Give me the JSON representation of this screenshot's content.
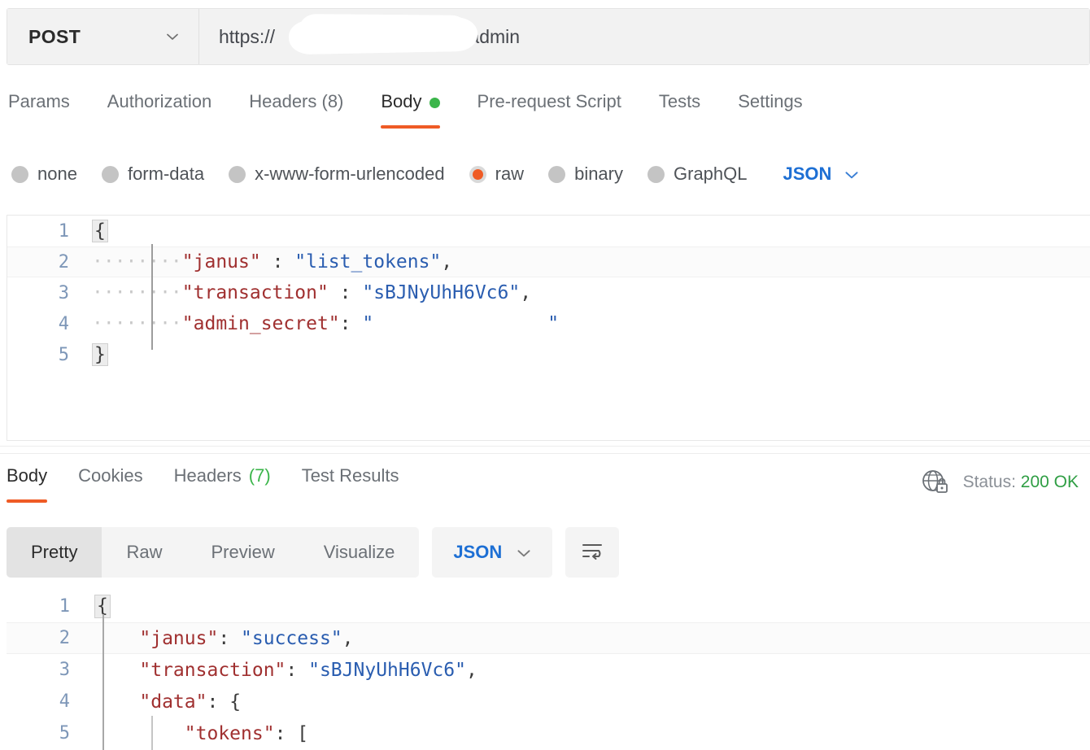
{
  "request_bar": {
    "method": "POST",
    "method_chevron_icon": "chevron-down-icon",
    "url_prefix": "https://",
    "url_host_redacted": "",
    "url_suffix": "/admin"
  },
  "request_tabs": {
    "items": [
      {
        "label": "Params",
        "active": false,
        "has_dot": false
      },
      {
        "label": "Authorization",
        "active": false,
        "has_dot": false
      },
      {
        "label": "Headers (8)",
        "active": false,
        "has_dot": false
      },
      {
        "label": "Body",
        "active": true,
        "has_dot": true
      },
      {
        "label": "Pre-request Script",
        "active": false,
        "has_dot": false
      },
      {
        "label": "Tests",
        "active": false,
        "has_dot": false
      },
      {
        "label": "Settings",
        "active": false,
        "has_dot": false
      }
    ],
    "active_underline_color": "#ef5b25",
    "dot_color": "#3bb54a"
  },
  "body_types": {
    "options": [
      {
        "label": "none",
        "selected": false
      },
      {
        "label": "form-data",
        "selected": false
      },
      {
        "label": "x-www-form-urlencoded",
        "selected": false
      },
      {
        "label": "raw",
        "selected": true
      },
      {
        "label": "binary",
        "selected": false
      },
      {
        "label": "GraphQL",
        "selected": false
      }
    ],
    "selected_color": "#ef5b25",
    "format": "JSON",
    "format_chevron_icon": "chevron-down-icon"
  },
  "request_body": {
    "language": "JSON",
    "lines": [
      {
        "num": "1",
        "open_brace": "{"
      },
      {
        "num": "2",
        "ws": "········",
        "key": "\"janus\"",
        "colon": " : ",
        "value": "\"list_tokens\"",
        "comma": ","
      },
      {
        "num": "3",
        "ws": "········",
        "key": "\"transaction\"",
        "colon": " : ",
        "value": "\"sBJNyUhH6Vc6\"",
        "comma": ","
      },
      {
        "num": "4",
        "ws": "········",
        "key": "\"admin_secret\"",
        "colon": ": ",
        "value_open_quote": "\"",
        "value_redacted": "",
        "value_close_quote": "\""
      },
      {
        "num": "5",
        "close_brace": "}"
      }
    ]
  },
  "response_tabs": {
    "items": [
      {
        "label": "Body",
        "active": true
      },
      {
        "label": "Cookies",
        "active": false
      },
      {
        "label": "Headers",
        "count": " (7)",
        "active": false
      },
      {
        "label": "Test Results",
        "active": false
      }
    ]
  },
  "response_status": {
    "icon": "globe-lock-icon",
    "prefix": "Status: ",
    "code_text": "200 OK",
    "color": "#2f9e44"
  },
  "response_toolbar": {
    "views": [
      {
        "label": "Pretty",
        "active": true
      },
      {
        "label": "Raw",
        "active": false
      },
      {
        "label": "Preview",
        "active": false
      },
      {
        "label": "Visualize",
        "active": false
      }
    ],
    "format": "JSON",
    "format_chevron_icon": "chevron-down-icon",
    "wrap_button_icon": "word-wrap-icon"
  },
  "response_body": {
    "lines": [
      {
        "num": "1",
        "open_brace": "{"
      },
      {
        "num": "2",
        "ws": "    ",
        "key": "\"janus\"",
        "colon": ": ",
        "value": "\"success\"",
        "comma": ","
      },
      {
        "num": "3",
        "ws": "    ",
        "key": "\"transaction\"",
        "colon": ": ",
        "value": "\"sBJNyUhH6Vc6\"",
        "comma": ","
      },
      {
        "num": "4",
        "ws": "    ",
        "key": "\"data\"",
        "colon": ": ",
        "value": "{",
        "comma": ""
      },
      {
        "num": "5",
        "ws": "        ",
        "key": "\"tokens\"",
        "colon": ": ",
        "value": "[",
        "comma": ""
      }
    ]
  },
  "colors": {
    "accent_orange": "#ef5b25",
    "key_red": "#a03030",
    "value_blue": "#2a5db0",
    "link_blue": "#1d6fd4",
    "gutter_blue": "#7e97b8",
    "green": "#3bb54a"
  }
}
